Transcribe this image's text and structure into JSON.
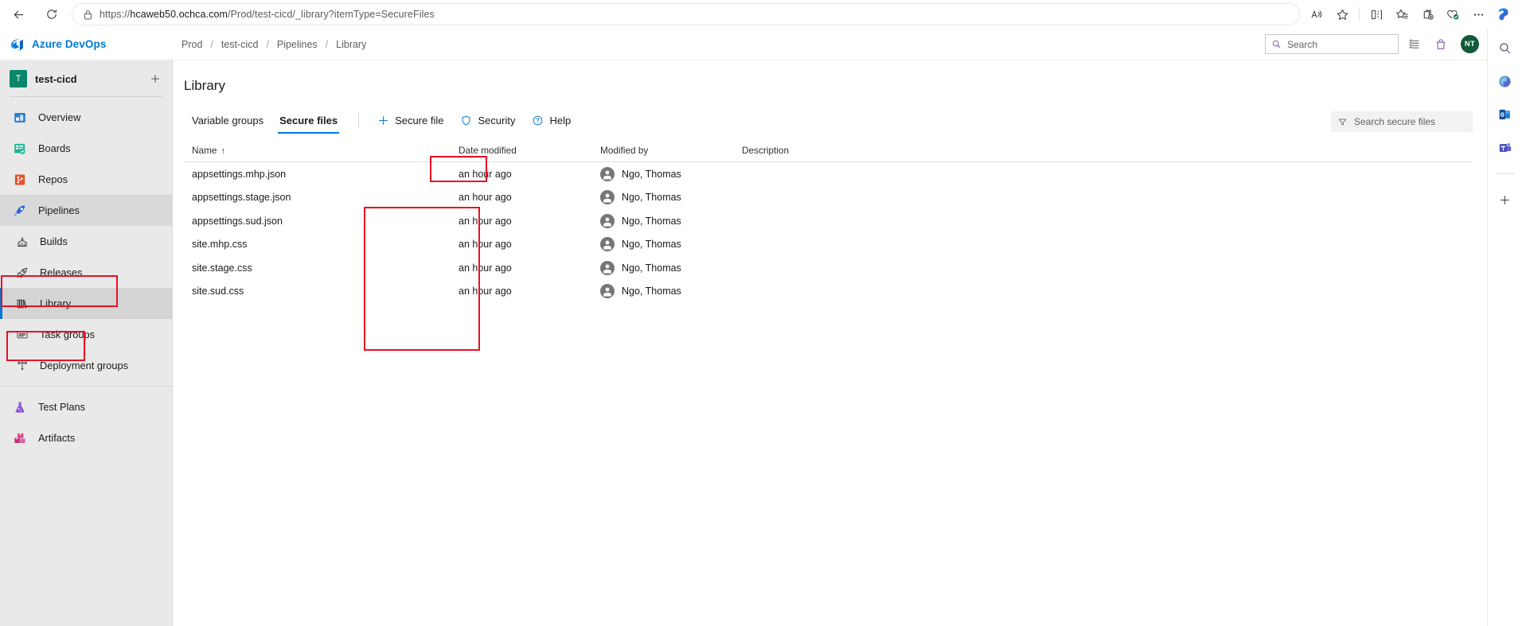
{
  "browser": {
    "back_icon": "back-arrow-icon",
    "refresh_icon": "refresh-icon",
    "lock_icon": "lock-icon",
    "url_full": "https://hcaweb50.ochca.com/Prod/test-cicd/_library?itemType=SecureFiles",
    "url_scheme": "https://",
    "url_host": "hcaweb50.ochca.com",
    "url_path": "/Prod/test-cicd/_library?itemType=SecureFiles",
    "toolbar_icons": [
      {
        "name": "read-aloud-icon",
        "label": "Read aloud"
      },
      {
        "name": "favorite-star-icon",
        "label": "Add this page to favorites"
      },
      {
        "name": "split-screen-icon",
        "label": "Split screen"
      },
      {
        "name": "favorites-list-icon",
        "label": "Favorites"
      },
      {
        "name": "collections-icon",
        "label": "Collections"
      },
      {
        "name": "browser-essentials-icon",
        "label": "Browser essentials"
      },
      {
        "name": "settings-more-icon",
        "label": "Settings and more"
      },
      {
        "name": "copilot-icon",
        "label": "Copilot"
      }
    ],
    "rail_icons": [
      {
        "name": "search-rail-icon",
        "label": "Search"
      },
      {
        "name": "copilot-rail-icon",
        "label": "Copilot"
      },
      {
        "name": "outlook-rail-icon",
        "label": "Outlook"
      },
      {
        "name": "teams-rail-icon",
        "label": "Teams"
      },
      {
        "name": "add-rail-icon",
        "label": "Customize"
      }
    ]
  },
  "header": {
    "logo_icon": "azure-devops-logo-icon",
    "product_name": "Azure DevOps",
    "breadcrumb": [
      "Prod",
      "test-cicd",
      "Pipelines",
      "Library"
    ],
    "breadcrumb_separator": "/",
    "search_placeholder": "Search",
    "search_icon": "search-icon",
    "actions": [
      {
        "name": "marketplace-icon",
        "label": "Marketplace"
      },
      {
        "name": "shopping-bag-icon",
        "label": "Shopping bag"
      }
    ],
    "avatar_initials": "NT",
    "avatar_color": "#105a39"
  },
  "sidebar": {
    "project": {
      "badge_letter": "T",
      "badge_color": "#09856c",
      "name": "test-cicd",
      "add_icon": "plus-icon"
    },
    "items": [
      {
        "label": "Overview",
        "icon": "overview-icon",
        "level": "top",
        "state": "normal"
      },
      {
        "label": "Boards",
        "icon": "boards-icon",
        "level": "top",
        "state": "normal"
      },
      {
        "label": "Repos",
        "icon": "repos-icon",
        "level": "top",
        "state": "normal"
      },
      {
        "label": "Pipelines",
        "icon": "pipelines-rocket-icon",
        "level": "top",
        "state": "expanded"
      },
      {
        "label": "Builds",
        "icon": "builds-icon",
        "level": "sub",
        "state": "normal"
      },
      {
        "label": "Releases",
        "icon": "releases-rocket-icon",
        "level": "sub",
        "state": "normal"
      },
      {
        "label": "Library",
        "icon": "library-books-icon",
        "level": "sub",
        "state": "selected"
      },
      {
        "label": "Task groups",
        "icon": "task-groups-icon",
        "level": "sub",
        "state": "normal"
      },
      {
        "label": "Deployment groups",
        "icon": "deployment-groups-icon",
        "level": "sub",
        "state": "normal"
      },
      {
        "label": "Test Plans",
        "icon": "test-plans-flask-icon",
        "level": "top",
        "state": "normal"
      },
      {
        "label": "Artifacts",
        "icon": "artifacts-boxes-icon",
        "level": "top",
        "state": "normal"
      }
    ]
  },
  "main": {
    "page_title": "Library",
    "tabs": [
      {
        "label": "Variable groups",
        "active": false
      },
      {
        "label": "Secure files",
        "active": true
      }
    ],
    "toolbar": [
      {
        "label": "Secure file",
        "icon": "plus-icon"
      },
      {
        "label": "Security",
        "icon": "shield-icon"
      },
      {
        "label": "Help",
        "icon": "question-circle-icon"
      }
    ],
    "filter": {
      "placeholder": "Search secure files",
      "icon": "filter-funnel-icon"
    },
    "table": {
      "columns": [
        "Name",
        "Date modified",
        "Modified by",
        "Description"
      ],
      "sort_column": "Name",
      "sort_indicator": "↑",
      "rows": [
        {
          "name": "appsettings.mhp.json",
          "date_modified": "an hour ago",
          "modified_by": "Ngo, Thomas",
          "description": ""
        },
        {
          "name": "appsettings.stage.json",
          "date_modified": "an hour ago",
          "modified_by": "Ngo, Thomas",
          "description": ""
        },
        {
          "name": "appsettings.sud.json",
          "date_modified": "an hour ago",
          "modified_by": "Ngo, Thomas",
          "description": ""
        },
        {
          "name": "site.mhp.css",
          "date_modified": "an hour ago",
          "modified_by": "Ngo, Thomas",
          "description": ""
        },
        {
          "name": "site.stage.css",
          "date_modified": "an hour ago",
          "modified_by": "Ngo, Thomas",
          "description": ""
        },
        {
          "name": "site.sud.css",
          "date_modified": "an hour ago",
          "modified_by": "Ngo, Thomas",
          "description": ""
        }
      ]
    }
  },
  "annotations": {
    "color": "#e81123",
    "boxes": [
      {
        "target": "sidebar-item-pipelines"
      },
      {
        "target": "sidebar-item-library"
      },
      {
        "target": "tab-secure-files"
      },
      {
        "target": "secure-files-name-column"
      }
    ]
  }
}
